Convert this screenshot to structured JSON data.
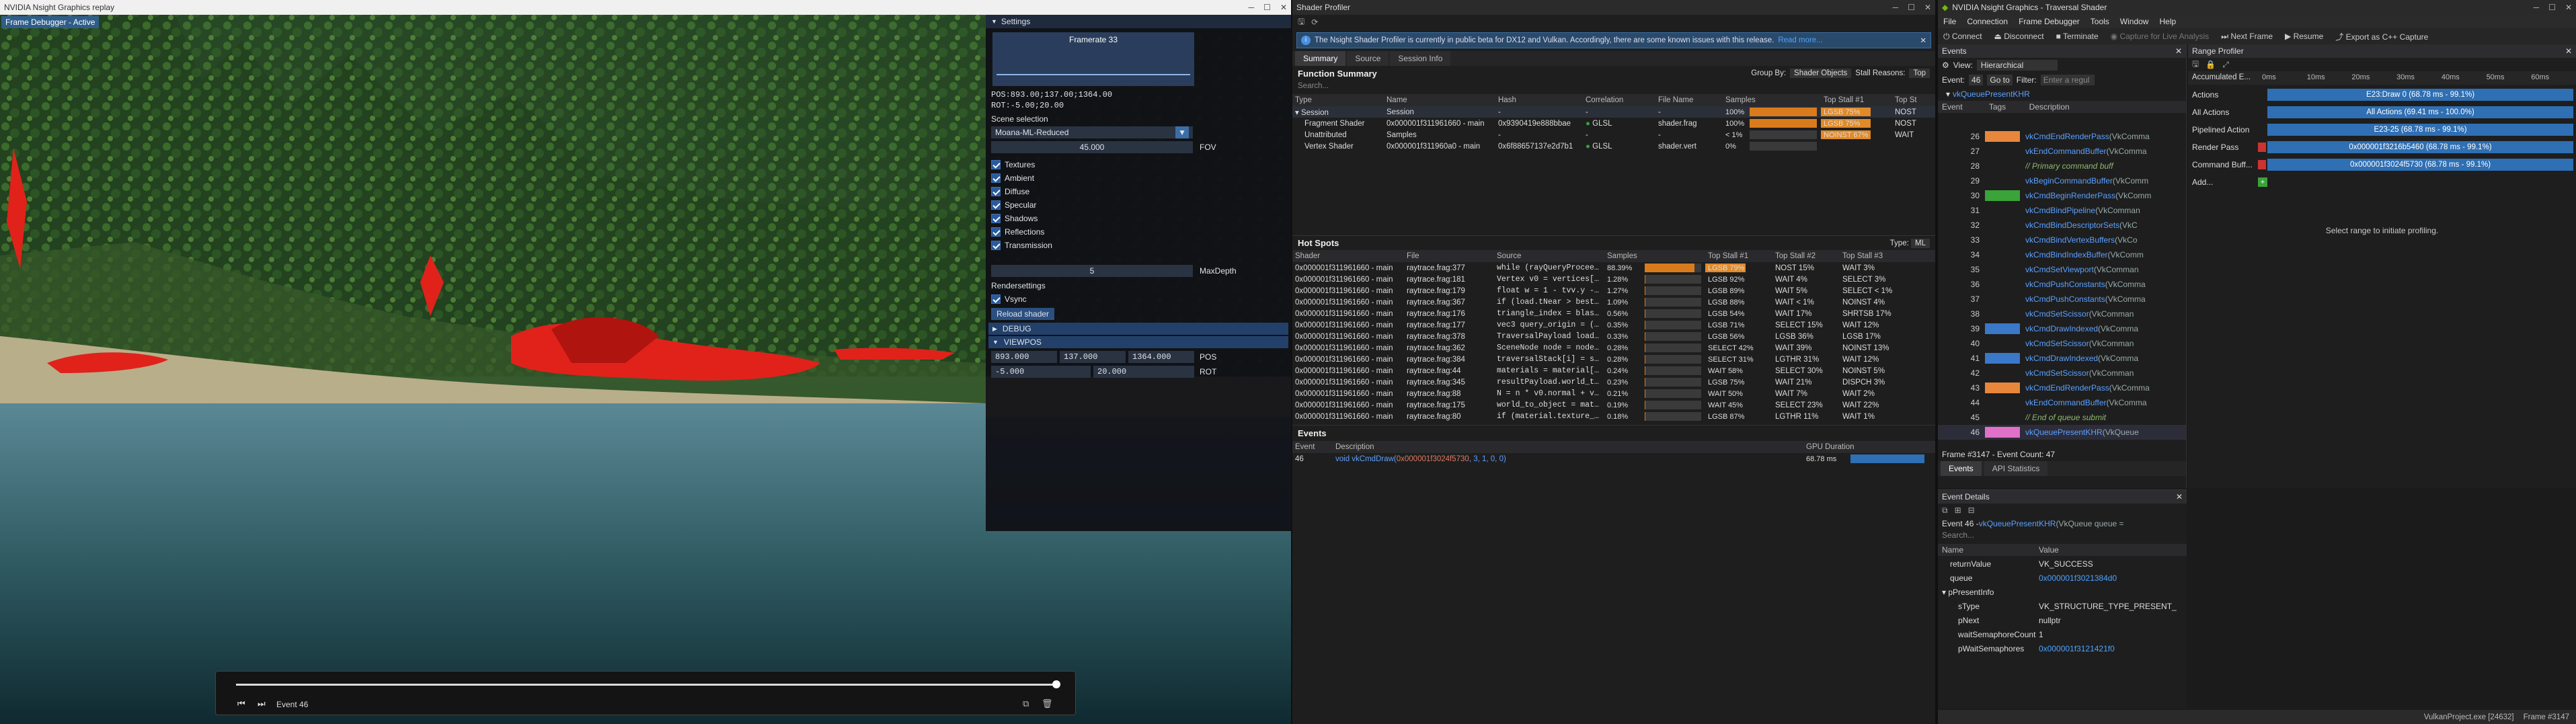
{
  "scene_window": {
    "title": "NVIDIA Nsight Graphics replay",
    "badge": "Frame Debugger - Active"
  },
  "settings": {
    "header": "Settings",
    "framerate": "Framerate 33",
    "scene_pos": "POS:893.00;137.00;1364.00",
    "scene_rot": "ROT:-5.00;20.00",
    "scene_selection_label": "Scene selection",
    "scene_selection_value": "Moana-ML-Reduced",
    "fov_value": "45.000",
    "fov_label": "FOV",
    "checkboxes": [
      "Textures",
      "Ambient",
      "Diffuse",
      "Specular",
      "Shadows",
      "Reflections",
      "Transmission"
    ],
    "maxdepth_value": "5",
    "maxdepth_label": "MaxDepth",
    "rendersettings_label": "Rendersettings",
    "vsync_label": "Vsync",
    "reload_shader": "Reload shader",
    "debug_label": "DEBUG",
    "viewpos_label": "VIEWPOS",
    "pos_x": "893.000",
    "pos_y": "137.000",
    "pos_z": "1364.000",
    "pos_label": "POS",
    "rot_x": "-5.000",
    "rot_y": "20.000",
    "rot_label": "ROT"
  },
  "playback": {
    "event_label": "Event 46",
    "progress": 1.0
  },
  "shader_profiler": {
    "title": "Shader Profiler",
    "banner": "The Nsight Shader Profiler is currently in public beta for DX12 and Vulkan. Accordingly, there are some known issues with this release.",
    "banner_link": "Read more...",
    "tabs": [
      "Summary",
      "Source",
      "Session Info"
    ],
    "function_summary": "Function Summary",
    "group_by_label": "Group By:",
    "group_by_value": "Shader Objects",
    "stall_reasons_label": "Stall Reasons:",
    "stall_reasons_value": "Top",
    "search_placeholder": "Search...",
    "fs_columns": [
      "Type",
      "Name",
      "Hash",
      "Correlation",
      "File Name",
      "Samples",
      "Top Stall #1",
      "Top St"
    ],
    "fs_rows": [
      {
        "type": "Session",
        "name": "Session",
        "hash": "-",
        "corr": "-",
        "file": "-",
        "samples": "100%",
        "pct": 1.0,
        "stall1": "LGSB",
        "stall1_pct": "75%",
        "stall2": "NOST"
      },
      {
        "type": "Fragment Shader",
        "name": "0x000001f311961660 - main",
        "hash": "0x9390419e888bbae",
        "corr": "GLSL",
        "file": "shader.frag",
        "samples": "100%",
        "pct": 1.0,
        "stall1": "LGSB",
        "stall1_pct": "75%",
        "stall2": "NOST"
      },
      {
        "type": "Unattributed",
        "name": "Samples",
        "hash": "-",
        "corr": "-",
        "file": "-",
        "samples": "< 1%",
        "pct": 0.0,
        "stall1": "NOINST",
        "stall1_pct": "67%",
        "stall2": "WAIT"
      },
      {
        "type": "Vertex Shader",
        "name": "0x000001f311960a0 - main",
        "hash": "0x6f88657137e2d7b1",
        "corr": "GLSL",
        "file": "shader.vert",
        "samples": "0%",
        "pct": 0.0,
        "stall1": "",
        "stall1_pct": "",
        "stall2": ""
      }
    ],
    "hot_spots": "Hot Spots",
    "hs_type_label": "Type:",
    "hs_type_value": "ML",
    "hs_columns": [
      "Shader",
      "File",
      "Source",
      "Samples",
      "Top Stall #1",
      "Top Stall #2",
      "Top Stall #3"
    ],
    "hs_rows": [
      {
        "shader": "0x000001f311961660 - main",
        "file": "raytrace.frag:377",
        "src": "while (rayQueryProceed...",
        "samples": "88.39%",
        "pct": 0.8839,
        "s1": "LGSB",
        "s1p": "79%",
        "s2": "NOST",
        "s2p": "15%",
        "s3": "WAIT",
        "s3p": "3%"
      },
      {
        "shader": "0x000001f311961660 - main",
        "file": "raytrace.frag:181",
        "src": "Vertex v0 = vertices[i...",
        "samples": "1.28%",
        "pct": 0.0128,
        "s1": "LGSB",
        "s1p": "92%",
        "s2": "WAIT",
        "s2p": "4%",
        "s3": "SELECT",
        "s3p": "3%"
      },
      {
        "shader": "0x000001f311961660 - main",
        "file": "raytrace.frag:179",
        "src": "float w = 1 - tvv.y - ...",
        "samples": "1.27%",
        "pct": 0.0127,
        "s1": "LGSB",
        "s1p": "89%",
        "s2": "WAIT",
        "s2p": "5%",
        "s3": "SELECT",
        "s3p": "< 1%"
      },
      {
        "shader": "0x000001f311961660 - main",
        "file": "raytrace.frag:367",
        "src": "if (load.tNear > best...",
        "samples": "1.09%",
        "pct": 0.0109,
        "s1": "LGSB",
        "s1p": "88%",
        "s2": "WAIT",
        "s2p": "< 1%",
        "s3": "NOINST",
        "s3p": "4%"
      },
      {
        "shader": "0x000001f311961660 - main",
        "file": "raytrace.frag:176",
        "src": "triangle_index = blasC...",
        "samples": "0.56%",
        "pct": 0.0056,
        "s1": "LGSB",
        "s1p": "54%",
        "s2": "WAIT",
        "s2p": "17%",
        "s3": "SHRTSB",
        "s3p": "17%"
      },
      {
        "shader": "0x000001f311961660 - main",
        "file": "raytrace.frag:177",
        "src": "vec3 query_origin = (l...",
        "samples": "0.35%",
        "pct": 0.0035,
        "s1": "LGSB",
        "s1p": "71%",
        "s2": "SELECT",
        "s2p": "15%",
        "s3": "WAIT",
        "s3p": "12%"
      },
      {
        "shader": "0x000001f311961660 - main",
        "file": "raytrace.frag:378",
        "src": "TraversalPayload load ...",
        "samples": "0.33%",
        "pct": 0.0033,
        "s1": "LGSB",
        "s1p": "56%",
        "s2": "LGSB",
        "s2p": "36%",
        "s3": "LGSB",
        "s3p": "17%"
      },
      {
        "shader": "0x000001f311961660 - main",
        "file": "raytrace.frag:362",
        "src": "SceneNode node = nodes...",
        "samples": "0.28%",
        "pct": 0.0028,
        "s1": "SELECT",
        "s1p": "42%",
        "s2": "WAIT",
        "s2p": "39%",
        "s3": "NOINST",
        "s3p": "13%"
      },
      {
        "shader": "0x000001f311961660 - main",
        "file": "raytrace.frag:384",
        "src": "traversalStack[i] = st...",
        "samples": "0.28%",
        "pct": 0.0028,
        "s1": "SELECT",
        "s1p": "31%",
        "s2": "LGTHR",
        "s2p": "31%",
        "s3": "WAIT",
        "s3p": "12%"
      },
      {
        "shader": "0x000001f311961660 - main",
        "file": "raytrace.frag:44",
        "src": "materials = material[s...",
        "samples": "0.24%",
        "pct": 0.0024,
        "s1": "WAIT",
        "s1p": "58%",
        "s2": "SELECT",
        "s2p": "30%",
        "s3": "NOINST",
        "s3p": "5%"
      },
      {
        "shader": "0x000001f311961660 - main",
        "file": "raytrace.frag:345",
        "src": "resultPayload.world_to...",
        "samples": "0.23%",
        "pct": 0.0023,
        "s1": "LGSB",
        "s1p": "75%",
        "s2": "WAIT",
        "s2p": "21%",
        "s3": "DISPCH",
        "s3p": "3%"
      },
      {
        "shader": "0x000001f311961660 - main",
        "file": "raytrace.frag:88",
        "src": "N = n * v0.normal + v...",
        "samples": "0.21%",
        "pct": 0.0021,
        "s1": "WAIT",
        "s1p": "50%",
        "s2": "WAIT",
        "s2p": "7%",
        "s3": "WAIT",
        "s3p": "2%"
      },
      {
        "shader": "0x000001f311961660 - main",
        "file": "raytrace.frag:175",
        "src": "world_to_object = mat...",
        "samples": "0.19%",
        "pct": 0.0019,
        "s1": "WAIT",
        "s1p": "45%",
        "s2": "SELECT",
        "s2p": "23%",
        "s3": "WAIT",
        "s3p": "22%"
      },
      {
        "shader": "0x000001f311961660 - main",
        "file": "raytrace.frag:80",
        "src": "if (material.texture_i...",
        "samples": "0.18%",
        "pct": 0.0018,
        "s1": "LGSB",
        "s1p": "87%",
        "s2": "LGTHR",
        "s2p": "11%",
        "s3": "WAIT",
        "s3p": "1%"
      }
    ],
    "events_title": "Events",
    "ev_columns": [
      "Event",
      "Description",
      "GPU Duration"
    ],
    "ev_row": {
      "num": "46",
      "desc_prefix": "void vkCmdDraw(",
      "desc_args": "0x000001f3024f5730",
      "desc_rest": ", 3, 1, 0, 0)",
      "duration": "68.78 ms"
    }
  },
  "trav_window": {
    "title": "NVIDIA Nsight Graphics - Traversal Shader",
    "menu": [
      "File",
      "Connection",
      "Frame Debugger",
      "Tools",
      "Window",
      "Help"
    ],
    "toolbar": [
      "Connect",
      "Disconnect",
      "Terminate",
      "Capture for Live Analysis",
      "Next Frame",
      "Resume",
      "Export as C++ Capture"
    ]
  },
  "events_panel": {
    "title": "Events",
    "view_label": "View:",
    "view_value": "Hierarchical",
    "event_label": "Event:",
    "event_value": "46",
    "goto_label": "Go to",
    "filter_label": "Filter:",
    "filter_placeholder": "Enter a regul",
    "queue_node": "vkQueuePresentKHR",
    "columns": [
      "Event",
      "Tags",
      "Description"
    ],
    "rows": [
      {
        "num": "26",
        "tag": "#e8873c",
        "api": "vkCmdEndRenderPass",
        "rest": "(VkComma"
      },
      {
        "num": "27",
        "tag": "",
        "api": "vkEndCommandBuffer",
        "rest": "(VkComma"
      },
      {
        "num": "28",
        "tag": "",
        "cmt": "// Primary command buff"
      },
      {
        "num": "29",
        "tag": "",
        "api": "vkBeginCommandBuffer",
        "rest": "(VkComm"
      },
      {
        "num": "30",
        "tag": "#3aa339",
        "api": "vkCmdBeginRenderPass",
        "rest": "(VkComm"
      },
      {
        "num": "31",
        "tag": "",
        "api": "vkCmdBindPipeline",
        "rest": "(VkComman"
      },
      {
        "num": "32",
        "tag": "",
        "api": "vkCmdBindDescriptorSets",
        "rest": "(VkC"
      },
      {
        "num": "33",
        "tag": "",
        "api": "vkCmdBindVertexBuffers",
        "rest": "(VkCo"
      },
      {
        "num": "34",
        "tag": "",
        "api": "vkCmdBindIndexBuffer",
        "rest": "(VkComm"
      },
      {
        "num": "35",
        "tag": "",
        "api": "vkCmdSetViewport",
        "rest": "(VkComman"
      },
      {
        "num": "36",
        "tag": "",
        "api": "vkCmdPushConstants",
        "rest": "(VkComma"
      },
      {
        "num": "37",
        "tag": "",
        "api": "vkCmdPushConstants",
        "rest": "(VkComma"
      },
      {
        "num": "38",
        "tag": "",
        "api": "vkCmdSetScissor",
        "rest": "(VkComman"
      },
      {
        "num": "39",
        "tag": "#3a78c9",
        "api": "vkCmdDrawIndexed",
        "rest": "(VkComma"
      },
      {
        "num": "40",
        "tag": "",
        "api": "vkCmdSetScissor",
        "rest": "(VkComman"
      },
      {
        "num": "41",
        "tag": "#3a78c9",
        "api": "vkCmdDrawIndexed",
        "rest": "(VkComma"
      },
      {
        "num": "42",
        "tag": "",
        "api": "vkCmdSetScissor",
        "rest": "(VkComman"
      },
      {
        "num": "43",
        "tag": "#e8873c",
        "api": "vkCmdEndRenderPass",
        "rest": "(VkComma"
      },
      {
        "num": "44",
        "tag": "",
        "api": "vkEndCommandBuffer",
        "rest": "(VkComma"
      },
      {
        "num": "45",
        "tag": "",
        "cmt": "// End of queue submit"
      },
      {
        "num": "46",
        "tag": "#e070c8",
        "api": "vkQueuePresentKHR",
        "rest": "(VkQueue"
      }
    ],
    "status": "Frame #3147 - Event Count: 47",
    "tabs": [
      "Events",
      "API Statistics"
    ]
  },
  "range_profiler": {
    "title": "Range Profiler",
    "accum_label": "Accumulated E...",
    "ticks": [
      "0ms",
      "10ms",
      "20ms",
      "30ms",
      "40ms",
      "50ms",
      "60ms"
    ],
    "rows": [
      {
        "label": "Actions",
        "bar": "E23:Draw 0 (68.78 ms - 99.1%)"
      },
      {
        "label": "All Actions",
        "bar": "All Actions (69.41 ms - 100.0%)"
      },
      {
        "label": "Pipelined Action",
        "bar": "E23-25 (68.78 ms - 99.1%)"
      },
      {
        "label": "Render Pass",
        "bar": "0x000001f3216b5460 (68.78 ms - 99.1%)"
      },
      {
        "label": "Command Buff...",
        "bar": "0x000001f3024f5730 (68.78 ms - 99.1%)"
      },
      {
        "label": "Add...",
        "bar": ""
      }
    ],
    "hint": "Select range to initiate profiling."
  },
  "event_details": {
    "title": "Event Details",
    "event_line_prefix": "Event 46 - ",
    "event_line_api": "vkQueuePresentKHR",
    "event_line_rest": "(VkQueue queue =",
    "search_placeholder": "Search...",
    "columns": [
      "Name",
      "Value"
    ],
    "rows": [
      {
        "name": "returnValue",
        "value": "VK_SUCCESS",
        "indent": 1,
        "link": false
      },
      {
        "name": "queue",
        "value": "0x000001f3021384d0",
        "indent": 1,
        "link": true
      },
      {
        "name": "pPresentInfo",
        "value": "",
        "indent": 0,
        "link": false
      },
      {
        "name": "sType",
        "value": "VK_STRUCTURE_TYPE_PRESENT_",
        "indent": 2,
        "link": false
      },
      {
        "name": "pNext",
        "value": "nullptr",
        "indent": 2,
        "link": false
      },
      {
        "name": "waitSemaphoreCount",
        "value": "1",
        "indent": 2,
        "link": false
      },
      {
        "name": "pWaitSemaphores",
        "value": "0x000001f3121421f0",
        "indent": 2,
        "link": true
      }
    ],
    "statusbar": "VulkanProject.exe [24632]",
    "frame_label": "Frame #3147"
  }
}
